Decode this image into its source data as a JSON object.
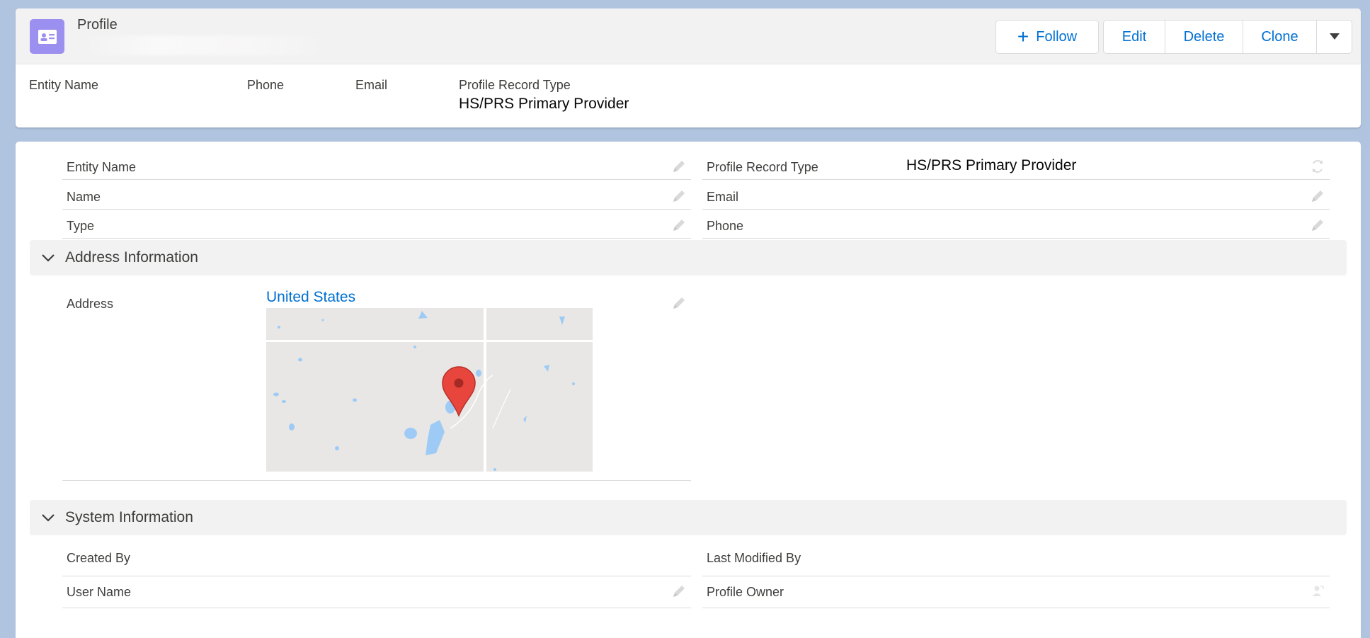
{
  "header": {
    "object_label": "Profile",
    "icon": "contact-card-icon",
    "buttons": {
      "follow": "Follow",
      "edit": "Edit",
      "delete": "Delete",
      "clone": "Clone"
    },
    "highlights": [
      {
        "label": "Entity Name",
        "value": ""
      },
      {
        "label": "Phone",
        "value": ""
      },
      {
        "label": "Email",
        "value": ""
      },
      {
        "label": "Profile Record Type",
        "value": "HS/PRS Primary Provider"
      }
    ]
  },
  "details": {
    "left": [
      {
        "label": "Entity Name",
        "value": ""
      },
      {
        "label": "Name",
        "value": ""
      },
      {
        "label": "Type",
        "value": ""
      }
    ],
    "right": [
      {
        "label": "Profile Record Type",
        "value": "HS/PRS Primary Provider"
      },
      {
        "label": "Email",
        "value": ""
      },
      {
        "label": "Phone",
        "value": ""
      }
    ]
  },
  "address_section": {
    "title": "Address Information",
    "field_label": "Address",
    "address_value": "United States"
  },
  "system_section": {
    "title": "System Information",
    "left": [
      {
        "label": "Created By",
        "value": ""
      },
      {
        "label": "User Name",
        "value": ""
      }
    ],
    "right": [
      {
        "label": "Last Modified By",
        "value": ""
      },
      {
        "label": "Profile Owner",
        "value": ""
      }
    ]
  },
  "colors": {
    "page_background": "#b0c4df",
    "brand_blue": "#0070d2",
    "object_icon": "#9b8ff0",
    "map_pin": "#e53935",
    "map_water": "#9ecbf5"
  }
}
